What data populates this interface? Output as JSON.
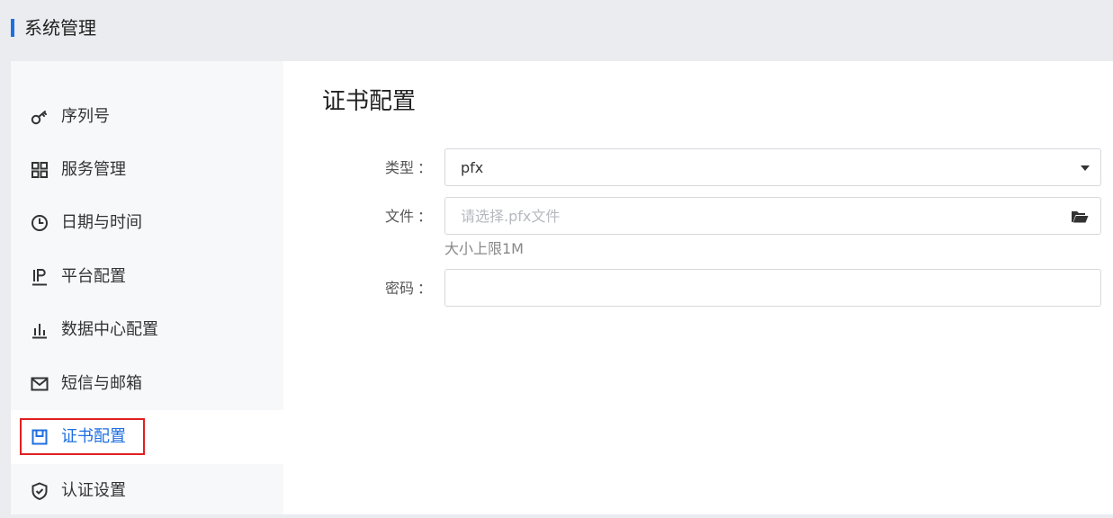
{
  "header": {
    "title": "系统管理",
    "accent_color": "#1f6fe0"
  },
  "sidebar": {
    "items": [
      {
        "label": "序列号",
        "icon": "key-icon"
      },
      {
        "label": "服务管理",
        "icon": "grid-icon"
      },
      {
        "label": "日期与时间",
        "icon": "clock-icon"
      },
      {
        "label": "平台配置",
        "icon": "ip-icon"
      },
      {
        "label": "数据中心配置",
        "icon": "bar-chart-icon"
      },
      {
        "label": "短信与邮箱",
        "icon": "mail-icon"
      },
      {
        "label": "证书配置",
        "icon": "certificate-icon",
        "active": true
      },
      {
        "label": "认证设置",
        "icon": "shield-icon"
      }
    ]
  },
  "main": {
    "title": "证书配置",
    "form": {
      "type": {
        "label": "类型",
        "colon": "：",
        "value": "pfx"
      },
      "file": {
        "label": "文件",
        "colon": "：",
        "placeholder": "请选择.pfx文件",
        "hint": "大小上限1M"
      },
      "password": {
        "label": "密码",
        "colon": "：",
        "value": ""
      }
    }
  },
  "colors": {
    "active": "#1f6fe0",
    "highlight_outline": "#e02020"
  }
}
